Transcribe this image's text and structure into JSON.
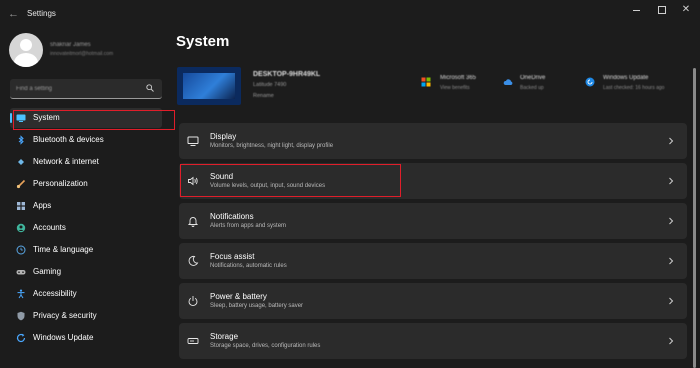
{
  "window": {
    "title": "Settings",
    "back_glyph": "←",
    "close_glyph": "✕"
  },
  "account": {
    "name": "shakriar James",
    "email": "innovateitmorl@hotmail.com"
  },
  "search": {
    "placeholder": "Find a setting"
  },
  "sidebar": {
    "items": [
      {
        "label": "System",
        "icon": "system-icon",
        "active": true
      },
      {
        "label": "Bluetooth & devices",
        "icon": "bluetooth-icon"
      },
      {
        "label": "Network & internet",
        "icon": "wifi-icon"
      },
      {
        "label": "Personalization",
        "icon": "brush-icon"
      },
      {
        "label": "Apps",
        "icon": "apps-icon"
      },
      {
        "label": "Accounts",
        "icon": "person-icon"
      },
      {
        "label": "Time & language",
        "icon": "globe-clock-icon"
      },
      {
        "label": "Gaming",
        "icon": "gamepad-icon"
      },
      {
        "label": "Accessibility",
        "icon": "accessibility-icon"
      },
      {
        "label": "Privacy & security",
        "icon": "shield-icon"
      },
      {
        "label": "Windows Update",
        "icon": "update-icon"
      }
    ]
  },
  "main": {
    "title": "System",
    "device": {
      "name": "DESKTOP-9HR49KL",
      "model": "Latitude 7490",
      "rename": "Rename"
    },
    "status": [
      {
        "title": "Microsoft 365",
        "subtitle": "View benefits",
        "icon": "microsoft365-icon"
      },
      {
        "title": "OneDrive",
        "subtitle": "Backed up",
        "icon": "cloud-icon"
      },
      {
        "title": "Windows Update",
        "subtitle": "Last checked: 16 hours ago",
        "icon": "windows-update-icon"
      }
    ],
    "cards": [
      {
        "title": "Display",
        "desc": "Monitors, brightness, night light, display profile",
        "icon": "display-icon"
      },
      {
        "title": "Sound",
        "desc": "Volume levels, output, input, sound devices",
        "icon": "speaker-icon"
      },
      {
        "title": "Notifications",
        "desc": "Alerts from apps and system",
        "icon": "bell-icon"
      },
      {
        "title": "Focus assist",
        "desc": "Notifications, automatic rules",
        "icon": "moon-icon"
      },
      {
        "title": "Power & battery",
        "desc": "Sleep, battery usage, battery saver",
        "icon": "power-icon"
      },
      {
        "title": "Storage",
        "desc": "Storage space, drives, configuration rules",
        "icon": "storage-icon"
      }
    ]
  },
  "colors": {
    "background": "#1c1c1c",
    "card": "#2b2b2b",
    "accent": "#4cc2ff",
    "highlight": "#e01e2a"
  }
}
